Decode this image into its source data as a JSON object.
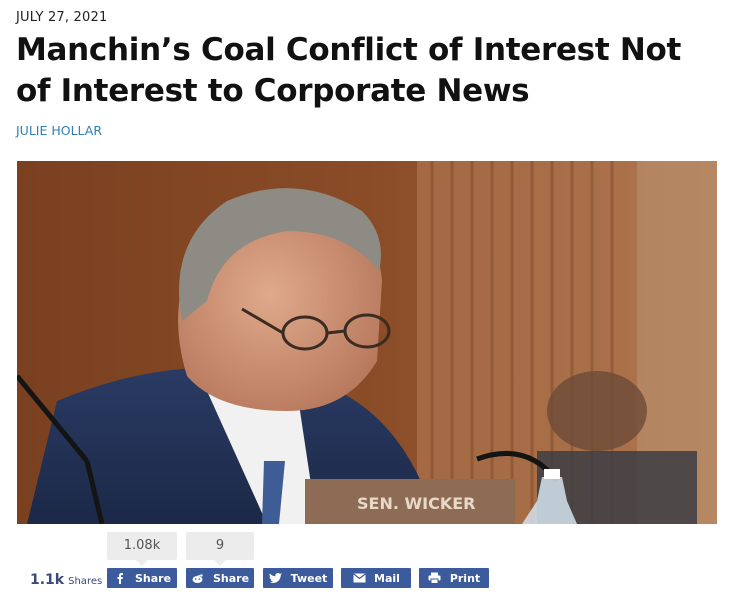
{
  "article": {
    "date": "JULY 27, 2021",
    "title": "Manchin’s Coal Conflict of Interest Not of Interest to Corporate News",
    "author": "JULIE HOLLAR"
  },
  "nameplate": "SEN. WICKER",
  "share": {
    "total_count": "1.1k",
    "total_label": "Shares",
    "facebook_count": "1.08k",
    "reddit_count": "9",
    "buttons": [
      {
        "label": "Share",
        "icon": "facebook-icon"
      },
      {
        "label": "Share",
        "icon": "reddit-icon"
      },
      {
        "label": "Tweet",
        "icon": "twitter-icon"
      },
      {
        "label": "Mail",
        "icon": "mail-icon"
      },
      {
        "label": "Print",
        "icon": "print-icon"
      }
    ],
    "button_color": "#3b5b9d"
  },
  "colors": {
    "author_link": "#2f7fb5"
  }
}
